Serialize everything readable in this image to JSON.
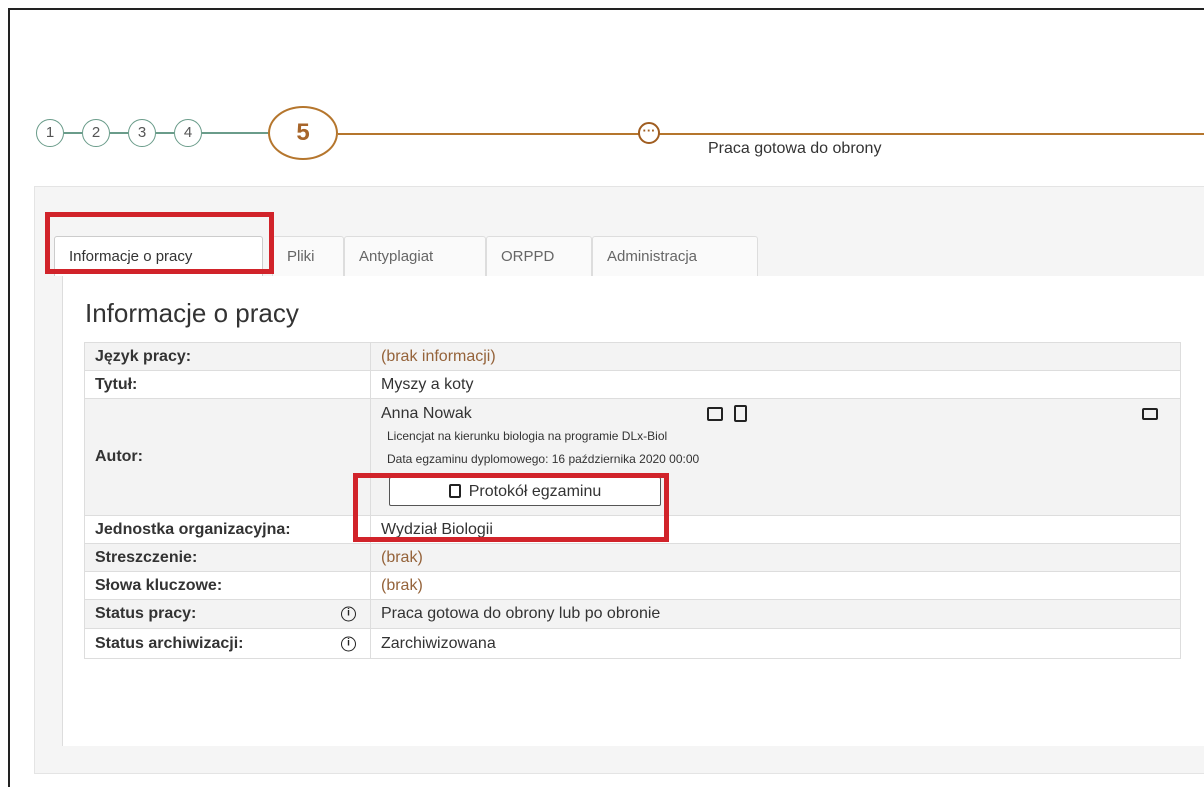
{
  "stepper": {
    "steps": [
      "1",
      "2",
      "3",
      "4"
    ],
    "active_step": "5",
    "status_caption": "Praca gotowa do obrony"
  },
  "tabs": [
    {
      "label": "Informacje o pracy",
      "active": true
    },
    {
      "label": "Pliki"
    },
    {
      "label": "Antyplagiat"
    },
    {
      "label": "ORPPD"
    },
    {
      "label": "Administracja"
    }
  ],
  "section_title": "Informacje o pracy",
  "rows": {
    "language": {
      "label": "Język pracy:",
      "value": "(brak informacji)"
    },
    "title": {
      "label": "Tytuł:",
      "value": "Myszy a koty"
    },
    "author": {
      "label": "Autor:",
      "name": "Anna Nowak",
      "program": "Licencjat na kierunku biologia na programie DLx-Biol",
      "exam_date": "Data egzaminu dyplomowego: 16 października 2020 00:00",
      "protocol_button": "Protokół egzaminu"
    },
    "unit": {
      "label": "Jednostka organizacyjna:",
      "value": "Wydział Biologii"
    },
    "abstract": {
      "label": "Streszczenie:",
      "value": "(brak)"
    },
    "keywords": {
      "label": "Słowa kluczowe:",
      "value": "(brak)"
    },
    "status": {
      "label": "Status pracy:",
      "value": "Praca gotowa do obrony lub po obronie"
    },
    "archive_status": {
      "label": "Status archiwizacji:",
      "value": "Zarchiwizowana"
    }
  },
  "colors": {
    "highlight_box": "#d1232a",
    "active_step": "#b5762d",
    "muted_value": "#95633a"
  }
}
